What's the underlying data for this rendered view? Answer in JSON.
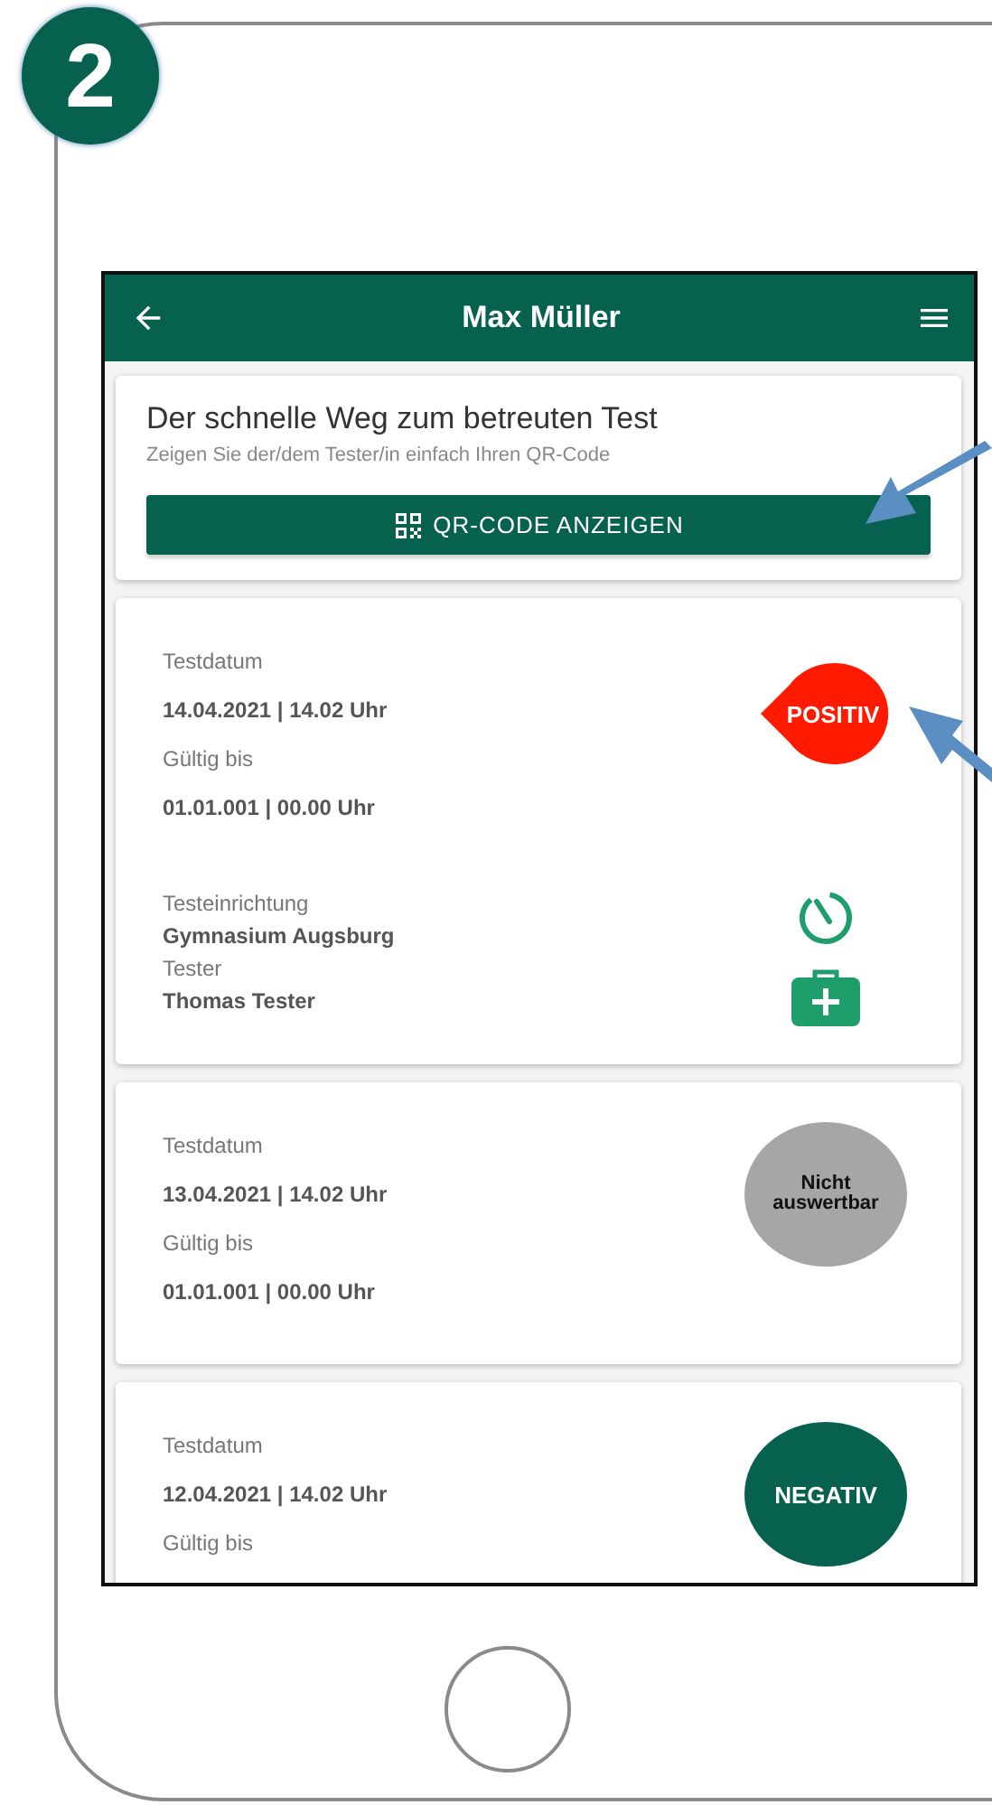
{
  "step_badge": "2",
  "app_bar": {
    "title": "Max Müller"
  },
  "qr_card": {
    "title": "Der schnelle Weg zum betreuten Test",
    "subtitle": "Zeigen Sie der/dem Tester/in einfach Ihren QR-Code",
    "button": "QR-CODE ANZEIGEN"
  },
  "tests": [
    {
      "date_label": "Testdatum",
      "date": "14.04.2021 | 14.02 Uhr",
      "valid_label": "Gültig bis",
      "valid": "01.01.001 | 00.00 Uhr",
      "result": {
        "kind": "positive",
        "label": "POSITIV"
      },
      "facility_label": "Testeinrichtung",
      "facility": "Gymnasium Augsburg",
      "tester_label": "Tester",
      "tester": "Thomas Tester"
    },
    {
      "date_label": "Testdatum",
      "date": "13.04.2021 | 14.02 Uhr",
      "valid_label": "Gültig bis",
      "valid": "01.01.001 | 00.00 Uhr",
      "result": {
        "kind": "invalid",
        "label": "Nicht auswertbar"
      }
    },
    {
      "date_label": "Testdatum",
      "date": "12.04.2021 | 14.02 Uhr",
      "valid_label": "Gültig bis",
      "result": {
        "kind": "negative",
        "label": "NEGATIV"
      }
    }
  ]
}
